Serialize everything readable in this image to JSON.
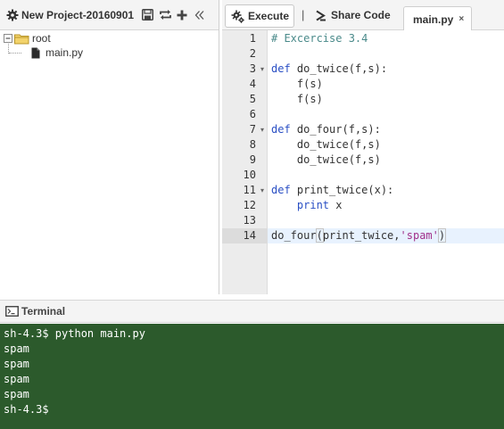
{
  "project": {
    "title": "New Project-20160901",
    "tree": {
      "root_label": "root",
      "file_label": "main.py"
    }
  },
  "toolbar": {
    "execute_label": "Execute",
    "separator": "|",
    "share_label": "Share Code",
    "tab_label": "main.py",
    "tab_close": "×"
  },
  "editor": {
    "lines": [
      {
        "n": "1",
        "fold": false,
        "parts": [
          {
            "t": "# Excercise 3.4",
            "c": "comment"
          }
        ]
      },
      {
        "n": "2",
        "fold": false,
        "parts": []
      },
      {
        "n": "3",
        "fold": true,
        "parts": [
          {
            "t": "def",
            "c": "kw"
          },
          {
            "t": " do_twice(f,s):",
            "c": ""
          }
        ]
      },
      {
        "n": "4",
        "fold": false,
        "parts": [
          {
            "t": "    f(s)",
            "c": ""
          }
        ]
      },
      {
        "n": "5",
        "fold": false,
        "parts": [
          {
            "t": "    f(s)",
            "c": ""
          }
        ]
      },
      {
        "n": "6",
        "fold": false,
        "parts": []
      },
      {
        "n": "7",
        "fold": true,
        "parts": [
          {
            "t": "def",
            "c": "kw"
          },
          {
            "t": " do_four(f,s):",
            "c": ""
          }
        ]
      },
      {
        "n": "8",
        "fold": false,
        "parts": [
          {
            "t": "    do_twice(f,s)",
            "c": ""
          }
        ]
      },
      {
        "n": "9",
        "fold": false,
        "parts": [
          {
            "t": "    do_twice(f,s)",
            "c": ""
          }
        ]
      },
      {
        "n": "10",
        "fold": false,
        "parts": []
      },
      {
        "n": "11",
        "fold": true,
        "parts": [
          {
            "t": "def",
            "c": "kw"
          },
          {
            "t": " print_twice(x):",
            "c": ""
          }
        ]
      },
      {
        "n": "12",
        "fold": false,
        "parts": [
          {
            "t": "    ",
            "c": ""
          },
          {
            "t": "print",
            "c": "kw"
          },
          {
            "t": " x",
            "c": ""
          }
        ]
      },
      {
        "n": "13",
        "fold": false,
        "parts": []
      },
      {
        "n": "14",
        "fold": false,
        "active": true,
        "parts": [
          {
            "t": "do_four",
            "c": ""
          },
          {
            "t": "(",
            "c": "paren-mark"
          },
          {
            "t": "print_twice,",
            "c": ""
          },
          {
            "t": "'spam'",
            "c": "str"
          },
          {
            "t": ")",
            "c": "paren-mark"
          }
        ]
      }
    ]
  },
  "terminal": {
    "title": "Terminal",
    "lines": [
      "sh-4.3$ python main.py",
      "spam",
      "spam",
      "spam",
      "spam",
      "sh-4.3$"
    ]
  },
  "colors": {
    "terminal_bg": "#2c5a2c",
    "keyword": "#2a4fc4",
    "string": "#a0308a",
    "comment": "#4a8a8a",
    "active_line": "#e8f2fe"
  },
  "icons": [
    "gear-icon",
    "save-icon",
    "sync-icon",
    "plus-icon",
    "collapse-icon",
    "folder-icon",
    "file-icon",
    "chevron-right-icon",
    "terminal-icon"
  ]
}
